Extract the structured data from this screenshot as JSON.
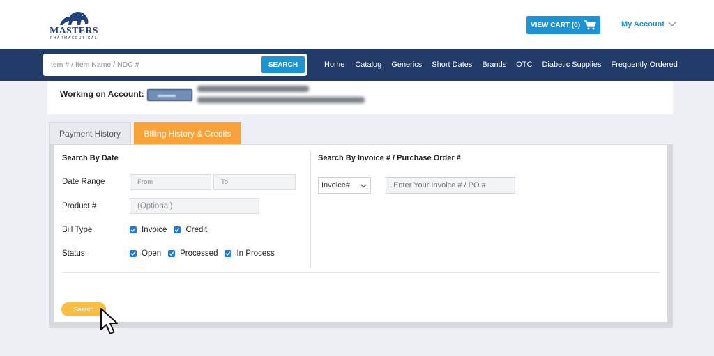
{
  "header": {
    "logo": {
      "text": "MASTERS",
      "sub": "PHARMACEUTICAL"
    },
    "view_cart_label": "VIEW CART (0)",
    "cart_icon": "cart-icon",
    "my_account_label": "My Account",
    "colors": {
      "brand_blue": "#223b69",
      "accent_blue": "#1e93d1",
      "orange": "#f7a23b",
      "yellow": "#f9bf42"
    }
  },
  "nav": {
    "search_placeholder": "Item # / Item Name / NDC #",
    "search_button": "SEARCH",
    "links": [
      "Home",
      "Catalog",
      "Generics",
      "Short Dates",
      "Brands",
      "OTC",
      "Diabetic Supplies",
      "Frequently Ordered"
    ]
  },
  "account": {
    "label": "Working on Account:"
  },
  "tabs": [
    {
      "label": "Payment History",
      "active": false
    },
    {
      "label": "Billing History & Credits",
      "active": true
    }
  ],
  "search_by_date": {
    "title": "Search By Date",
    "date_range_label": "Date Range",
    "from_placeholder": "From",
    "to_placeholder": "To",
    "product_label": "Product #",
    "product_placeholder": "(Optional)",
    "bill_type_label": "Bill Type",
    "bill_types": [
      {
        "label": "Invoice",
        "checked": true
      },
      {
        "label": "Credit",
        "checked": true
      }
    ],
    "status_label": "Status",
    "statuses": [
      {
        "label": "Open",
        "checked": true
      },
      {
        "label": "Processed",
        "checked": true
      },
      {
        "label": "In Process",
        "checked": true
      }
    ]
  },
  "search_by_invoice": {
    "title": "Search By Invoice # / Purchase Order #",
    "type_select_value": "Invoice#",
    "input_placeholder": "Enter Your Invoice # / PO #"
  },
  "search_button": "Search"
}
